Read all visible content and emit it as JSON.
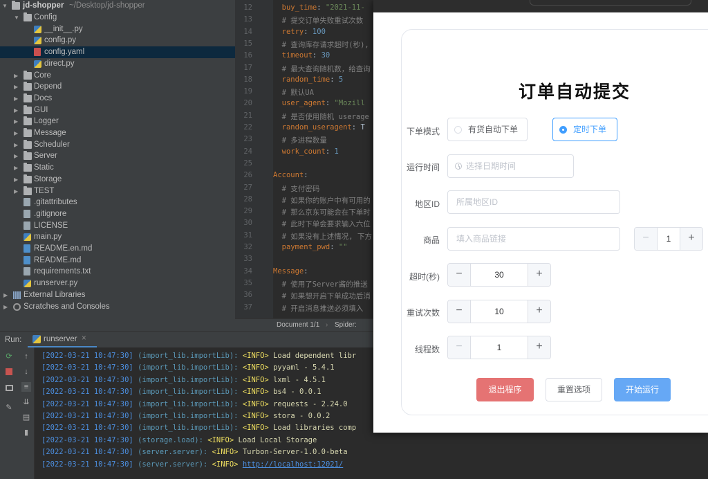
{
  "project": {
    "root_name": "jd-shopper",
    "root_path": "~/Desktop/jd-shopper",
    "items": [
      {
        "label": "Config",
        "type": "folder",
        "level": 1,
        "expanded": true
      },
      {
        "label": "__init__.py",
        "type": "py",
        "level": 2
      },
      {
        "label": "config.py",
        "type": "py",
        "level": 2
      },
      {
        "label": "config.yaml",
        "type": "yaml",
        "level": 2,
        "selected": true
      },
      {
        "label": "direct.py",
        "type": "py",
        "level": 2
      },
      {
        "label": "Core",
        "type": "folder",
        "level": 1
      },
      {
        "label": "Depend",
        "type": "folder",
        "level": 1
      },
      {
        "label": "Docs",
        "type": "folder",
        "level": 1
      },
      {
        "label": "GUI",
        "type": "folder",
        "level": 1
      },
      {
        "label": "Logger",
        "type": "folder",
        "level": 1
      },
      {
        "label": "Message",
        "type": "folder",
        "level": 1
      },
      {
        "label": "Scheduler",
        "type": "folder",
        "level": 1
      },
      {
        "label": "Server",
        "type": "folder",
        "level": 1
      },
      {
        "label": "Static",
        "type": "folder",
        "level": 1
      },
      {
        "label": "Storage",
        "type": "folder",
        "level": 1
      },
      {
        "label": "TEST",
        "type": "folder",
        "level": 1
      },
      {
        "label": ".gitattributes",
        "type": "file",
        "level": 1
      },
      {
        "label": ".gitignore",
        "type": "file",
        "level": 1
      },
      {
        "label": "LICENSE",
        "type": "file",
        "level": 1
      },
      {
        "label": "main.py",
        "type": "py",
        "level": 1
      },
      {
        "label": "README.en.md",
        "type": "md",
        "level": 1
      },
      {
        "label": "README.md",
        "type": "md",
        "level": 1
      },
      {
        "label": "requirements.txt",
        "type": "file",
        "level": 1
      },
      {
        "label": "runserver.py",
        "type": "py",
        "level": 1
      },
      {
        "label": "External Libraries",
        "type": "lib",
        "level": 0
      },
      {
        "label": "Scratches and Consoles",
        "type": "scratch",
        "level": 0
      }
    ]
  },
  "editor": {
    "lines": [
      {
        "n": "12",
        "parts": [
          [
            "c-key",
            "  buy_time"
          ],
          [
            "c-wht",
            ": "
          ],
          [
            "c-str",
            "\"2021-11-"
          ]
        ]
      },
      {
        "n": "13",
        "parts": [
          [
            "c-com",
            "  # 提交订单失败重试次数"
          ]
        ]
      },
      {
        "n": "14",
        "parts": [
          [
            "c-key",
            "  retry"
          ],
          [
            "c-wht",
            ": "
          ],
          [
            "c-num",
            "100"
          ]
        ]
      },
      {
        "n": "15",
        "parts": [
          [
            "c-com",
            "  # 查询库存请求超时(秒),"
          ]
        ]
      },
      {
        "n": "16",
        "parts": [
          [
            "c-key",
            "  timeout"
          ],
          [
            "c-wht",
            ": "
          ],
          [
            "c-num",
            "30"
          ]
        ]
      },
      {
        "n": "17",
        "parts": [
          [
            "c-com",
            "  # 最大查询随机数，给查询"
          ]
        ]
      },
      {
        "n": "18",
        "parts": [
          [
            "c-key",
            "  random_time"
          ],
          [
            "c-wht",
            ": "
          ],
          [
            "c-num",
            "5"
          ]
        ]
      },
      {
        "n": "19",
        "parts": [
          [
            "c-com",
            "  # 默认UA"
          ]
        ]
      },
      {
        "n": "20",
        "parts": [
          [
            "c-key",
            "  user_agent"
          ],
          [
            "c-wht",
            ": "
          ],
          [
            "c-str",
            "\"Mozill"
          ]
        ]
      },
      {
        "n": "21",
        "parts": [
          [
            "c-com",
            "  # 是否使用随机 userage"
          ]
        ]
      },
      {
        "n": "22",
        "parts": [
          [
            "c-key",
            "  random_useragent"
          ],
          [
            "c-wht",
            ": T"
          ]
        ]
      },
      {
        "n": "23",
        "parts": [
          [
            "c-com",
            "  # 多进程数量"
          ]
        ]
      },
      {
        "n": "24",
        "parts": [
          [
            "c-key",
            "  work_count"
          ],
          [
            "c-wht",
            ": "
          ],
          [
            "c-num",
            "1"
          ]
        ]
      },
      {
        "n": "25",
        "parts": []
      },
      {
        "n": "26",
        "parts": [
          [
            "c-sec",
            "Account"
          ],
          [
            "c-wht",
            ":"
          ]
        ]
      },
      {
        "n": "27",
        "parts": [
          [
            "c-com",
            "  # 支付密码"
          ]
        ]
      },
      {
        "n": "28",
        "parts": [
          [
            "c-com",
            "  # 如果你的账户中有可用的"
          ]
        ]
      },
      {
        "n": "29",
        "parts": [
          [
            "c-com",
            "  # 那么京东可能会在下单时"
          ]
        ]
      },
      {
        "n": "30",
        "parts": [
          [
            "c-com",
            "  # 此时下单会要求输入六位"
          ]
        ]
      },
      {
        "n": "31",
        "parts": [
          [
            "c-com",
            "  # 如果没有上述情况, 下方"
          ]
        ]
      },
      {
        "n": "32",
        "parts": [
          [
            "c-key",
            "  payment_pwd"
          ],
          [
            "c-wht",
            ": "
          ],
          [
            "c-str",
            "\"\""
          ]
        ]
      },
      {
        "n": "33",
        "parts": []
      },
      {
        "n": "34",
        "parts": [
          [
            "c-sec",
            "Message"
          ],
          [
            "c-wht",
            ":"
          ]
        ]
      },
      {
        "n": "35",
        "parts": [
          [
            "c-com",
            "  # 使用了Server酱的推送"
          ]
        ]
      },
      {
        "n": "36",
        "parts": [
          [
            "c-com",
            "  # 如果想开启下单成功后消"
          ]
        ]
      },
      {
        "n": "37",
        "parts": [
          [
            "c-com",
            "  # 开启消息推送必须填入"
          ]
        ]
      }
    ],
    "status_doc": "Document 1/1",
    "status_sep": "›",
    "status_spider": "Spider:"
  },
  "run": {
    "label": "Run:",
    "tab": "runserver",
    "close": "×",
    "lines": [
      {
        "date": "[2022-03-21 10:47:30]",
        "mod": "(import_lib.importLib):",
        "info": "<INFO>",
        "msg": "Load dependent libr",
        "link": false
      },
      {
        "date": "[2022-03-21 10:47:30]",
        "mod": "(import_lib.importLib):",
        "info": "<INFO>",
        "msg": "pyyaml - 5.4.1",
        "link": false
      },
      {
        "date": "[2022-03-21 10:47:30]",
        "mod": "(import_lib.importLib):",
        "info": "<INFO>",
        "msg": "lxml - 4.5.1",
        "link": false
      },
      {
        "date": "[2022-03-21 10:47:30]",
        "mod": "(import_lib.importLib):",
        "info": "<INFO>",
        "msg": "bs4 - 0.0.1",
        "link": false
      },
      {
        "date": "[2022-03-21 10:47:30]",
        "mod": "(import_lib.importLib):",
        "info": "<INFO>",
        "msg": "requests - 2.24.0",
        "link": false
      },
      {
        "date": "[2022-03-21 10:47:30]",
        "mod": "(import_lib.importLib):",
        "info": "<INFO>",
        "msg": "stora - 0.0.2",
        "link": false
      },
      {
        "date": "[2022-03-21 10:47:30]",
        "mod": "(import_lib.importLib):",
        "info": "<INFO>",
        "msg": "Load libraries comp",
        "link": false
      },
      {
        "date": "[2022-03-21 10:47:30]",
        "mod": "(storage.load):",
        "info": "<INFO>",
        "msg": "Load Local Storage",
        "link": false
      },
      {
        "date": "[2022-03-21 10:47:30]",
        "mod": "(server.server):",
        "info": "<INFO>",
        "msg": "Turbon-Server-1.0.0-beta",
        "link": false
      },
      {
        "date": "[2022-03-21 10:47:30]",
        "mod": "(server.server):",
        "info": "<INFO>",
        "msg": "http://localhost:12021/",
        "link": true
      }
    ]
  },
  "form": {
    "title": "订单自动提交",
    "mode_label": "下单模式",
    "mode_options": [
      "有货自动下单",
      "定时下单"
    ],
    "mode_selected": 1,
    "time_label": "运行时间",
    "time_placeholder": "选择日期时间",
    "area_label": "地区ID",
    "area_placeholder": "所属地区ID",
    "goods_label": "商品",
    "goods_placeholder": "填入商品链接",
    "goods_qty": "1",
    "timeout_label": "超时(秒)",
    "timeout_value": "30",
    "retry_label": "重试次数",
    "retry_value": "10",
    "thread_label": "线程数",
    "thread_value": "1",
    "minus": "−",
    "plus": "+",
    "btn_exit": "退出程序",
    "btn_reset": "重置选项",
    "btn_start": "开始运行"
  },
  "colors": {
    "primary": "#409eff",
    "danger": "#f56c6c",
    "start_btn": "#66a8f5",
    "exit_btn": "#e57373"
  }
}
